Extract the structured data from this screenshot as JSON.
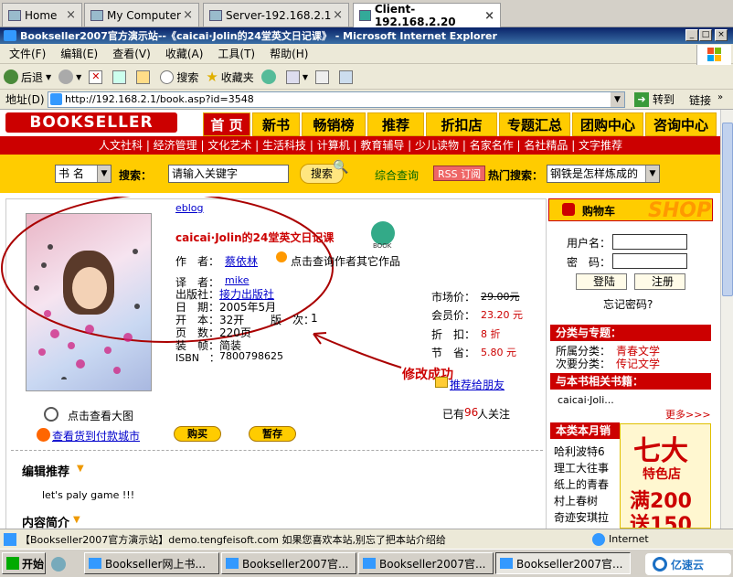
{
  "vm_tabs": [
    {
      "label": "Home"
    },
    {
      "label": "My Computer"
    },
    {
      "label": "Server-192.168.2.1"
    },
    {
      "label": "Client-192.168.2.20"
    }
  ],
  "window": {
    "title": "Bookseller2007官方演示站--《caicai·Jolin的24堂英文日记课》 - Microsoft Internet Explorer",
    "min": "_",
    "max": "□",
    "close": "×"
  },
  "menu": [
    "文件(F)",
    "编辑(E)",
    "查看(V)",
    "收藏(A)",
    "工具(T)",
    "帮助(H)"
  ],
  "toolbar": {
    "back": "后退",
    "search": "搜索",
    "favorites": "收藏夹"
  },
  "address": {
    "label": "地址(D)",
    "url": "http://192.168.2.1/book.asp?id=3548",
    "go": "转到",
    "links": "链接"
  },
  "site": {
    "logo": "BOOKSELLER",
    "nav": [
      "首 页",
      "新书",
      "畅销榜",
      "推荐",
      "折扣店",
      "专题汇总",
      "团购中心",
      "咨询中心"
    ],
    "subnav": "人文社科 | 经济管理 | 文化艺术 | 生活科技 | 计算机 | 教育辅导 | 少儿读物 | 名家名作 | 名社精品 | 文字推荐",
    "search": {
      "type": "书 名",
      "label": "搜索：",
      "placeholder": "请输入关键字",
      "button": "搜索",
      "advanced": "综合查询",
      "rss": "RSS 订阅",
      "hot_label": "热门搜索：",
      "hot_value": "钢铁是怎样炼成的"
    }
  },
  "book": {
    "blog_link": "eblog",
    "title": "caicai·Jolin的24堂英文日记课",
    "book_icon_label": "BOOK",
    "author_label": "作　者：",
    "author": "蔡依林",
    "author_more": "点击查询作者其它作品",
    "translator_label": "译　者：",
    "translator": "mike",
    "publisher_label": "出版社：",
    "publisher": "接力出版社",
    "date_label": "日　期：",
    "date": "2005年5月",
    "format_label": "开　本：",
    "format": "32开",
    "edition_label": "版　次：",
    "edition": "1",
    "pages_label": "页　数：",
    "pages": "220页",
    "binding_label": "装　帧：",
    "binding": "简装",
    "isbn_label": "ISBN　：",
    "isbn": "7800798625",
    "market_label": "市场价：",
    "market_price": "29.00元",
    "member_label": "会员价：",
    "member_price": "23.20 元",
    "discount_label": "折　扣：",
    "discount": "8 折",
    "save_label": "节　省：",
    "save": "5.80 元",
    "recommend": "推荐给朋友",
    "followers_prefix": "已有",
    "followers": "96",
    "followers_suffix": "人关注",
    "view_large": "点击查看大图",
    "cod_cities": "查看货到付款城市",
    "buy": "购买",
    "hold": "暂存"
  },
  "annotation": "修改成功",
  "sections": {
    "editor_pick": "编辑推荐",
    "editor_text": "let's paly game !!!",
    "intro": "内容简介"
  },
  "sidebar": {
    "cart": "购物车",
    "shop": "SHOP",
    "user_label": "用户名：",
    "pwd_label": "密　码：",
    "login": "登陆",
    "register": "注册",
    "forgot": "忘记密码?",
    "cat_head": "分类与专题：",
    "cat_label": "所属分类：",
    "cat_value": "青春文学",
    "subcat_label": "次要分类：",
    "subcat_value": "传记文学",
    "related_head": "与本书相关书籍：",
    "related_item": "caicai·Joli...",
    "more": "更多>>>",
    "monthly_head": "本类本月销",
    "monthly": [
      "哈利波特6",
      "理工大往事",
      "纸上的青春",
      "村上春树",
      "奇迹安琪拉"
    ],
    "ad_big": "七大",
    "ad_shop": "特色店",
    "ad_num1": "满200",
    "ad_num2": "送150"
  },
  "status": {
    "text": "【Bookseller2007官方演示站】demo.tengfeisoft.com 如果您喜欢本站,别忘了把本站介绍给",
    "zone": "Internet"
  },
  "taskbar": {
    "start": "开始",
    "tasks": [
      "Bookseller网上书...",
      "Bookseller2007官...",
      "Bookseller2007官...",
      "Bookseller2007官..."
    ],
    "watermark": "亿速云"
  }
}
